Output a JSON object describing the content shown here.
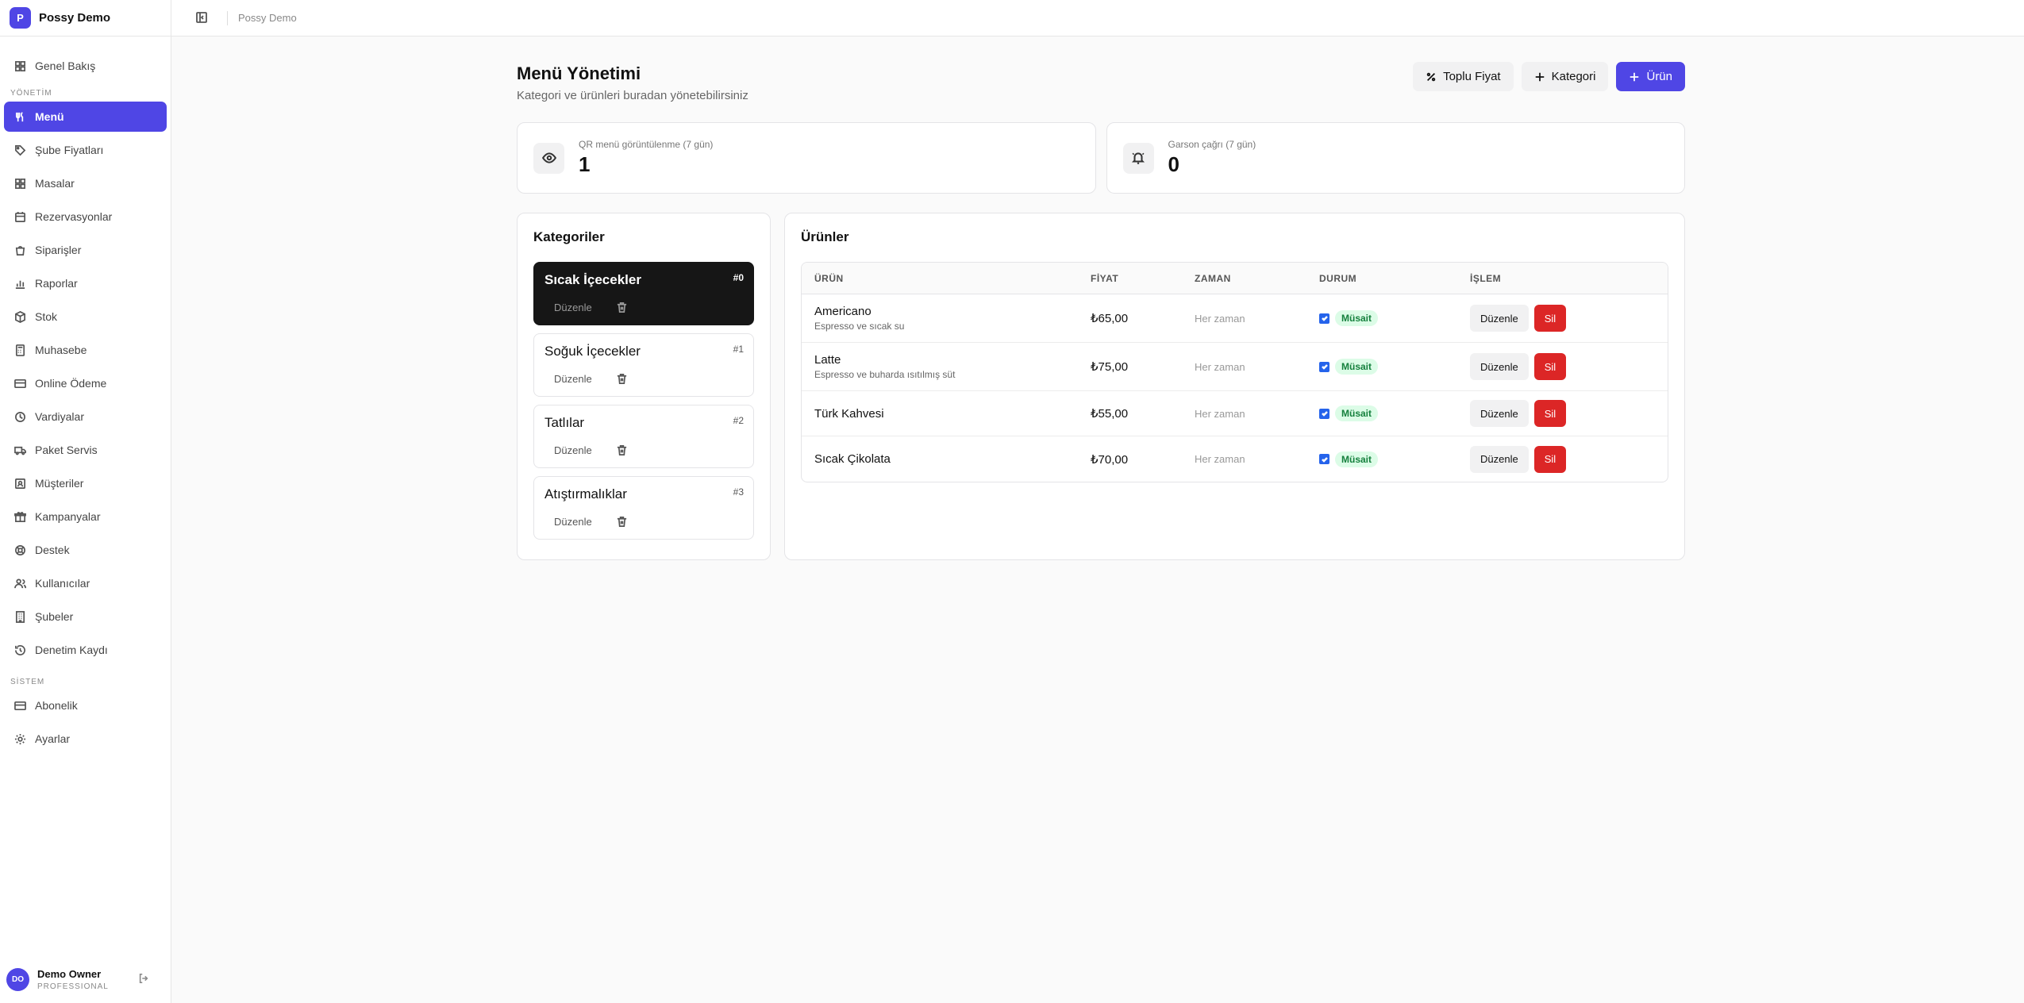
{
  "brand": {
    "logo_letter": "P",
    "name": "Possy Demo",
    "accent": "#4f46e5"
  },
  "sidebar": {
    "top_items": [
      {
        "label": "Genel Bakış",
        "icon": "grid-icon"
      }
    ],
    "section_management": "YÖNETİM",
    "management_items": [
      {
        "label": "Menü",
        "icon": "utensils-icon",
        "active": true
      },
      {
        "label": "Şube Fiyatları",
        "icon": "tag-icon"
      },
      {
        "label": "Masalar",
        "icon": "grid-icon"
      },
      {
        "label": "Rezervasyonlar",
        "icon": "calendar-icon"
      },
      {
        "label": "Siparişler",
        "icon": "bag-icon"
      },
      {
        "label": "Raporlar",
        "icon": "bar-chart-icon"
      },
      {
        "label": "Stok",
        "icon": "box-icon"
      },
      {
        "label": "Muhasebe",
        "icon": "calculator-icon"
      },
      {
        "label": "Online Ödeme",
        "icon": "credit-card-icon"
      },
      {
        "label": "Vardiyalar",
        "icon": "clock-icon"
      },
      {
        "label": "Paket Servis",
        "icon": "truck-icon"
      },
      {
        "label": "Müşteriler",
        "icon": "contact-icon"
      },
      {
        "label": "Kampanyalar",
        "icon": "gift-icon"
      },
      {
        "label": "Destek",
        "icon": "lifebuoy-icon"
      },
      {
        "label": "Kullanıcılar",
        "icon": "users-icon"
      },
      {
        "label": "Şubeler",
        "icon": "building-icon"
      },
      {
        "label": "Denetim Kaydı",
        "icon": "history-icon"
      }
    ],
    "section_system": "SİSTEM",
    "system_items": [
      {
        "label": "Abonelik",
        "icon": "credit-card-icon"
      },
      {
        "label": "Ayarlar",
        "icon": "gear-icon"
      }
    ],
    "user": {
      "initials": "DO",
      "name": "Demo Owner",
      "plan": "PROFESSIONAL"
    }
  },
  "topbar": {
    "breadcrumb": "Possy Demo"
  },
  "header": {
    "title": "Menü Yönetimi",
    "subtitle": "Kategori ve ürünleri buradan yönetebilirsiniz",
    "bulk_price_label": "Toplu Fiyat",
    "add_category_label": "Kategori",
    "add_product_label": "Ürün"
  },
  "stats": [
    {
      "label": "QR menü görüntülenme (7 gün)",
      "value": "1",
      "icon": "eye-icon"
    },
    {
      "label": "Garson çağrı (7 gün)",
      "value": "0",
      "icon": "bell-icon"
    }
  ],
  "categories_panel": {
    "title": "Kategoriler",
    "edit_label": "Düzenle",
    "items": [
      {
        "name": "Sıcak İçecekler",
        "index": "#0",
        "active": true
      },
      {
        "name": "Soğuk İçecekler",
        "index": "#1"
      },
      {
        "name": "Tatlılar",
        "index": "#2"
      },
      {
        "name": "Atıştırmalıklar",
        "index": "#3"
      }
    ]
  },
  "products_panel": {
    "title": "Ürünler",
    "columns": [
      "ÜRÜN",
      "FİYAT",
      "ZAMAN",
      "DURUM",
      "İŞLEM"
    ],
    "edit_label": "Düzenle",
    "delete_label": "Sil",
    "rows": [
      {
        "name": "Americano",
        "desc": "Espresso ve sıcak su",
        "price": "₺65,00",
        "time": "Her zaman",
        "status": "Müsait"
      },
      {
        "name": "Latte",
        "desc": "Espresso ve buharda ısıtılmış süt",
        "price": "₺75,00",
        "time": "Her zaman",
        "status": "Müsait"
      },
      {
        "name": "Türk Kahvesi",
        "desc": "",
        "price": "₺55,00",
        "time": "Her zaman",
        "status": "Müsait"
      },
      {
        "name": "Sıcak Çikolata",
        "desc": "",
        "price": "₺70,00",
        "time": "Her zaman",
        "status": "Müsait"
      }
    ]
  }
}
